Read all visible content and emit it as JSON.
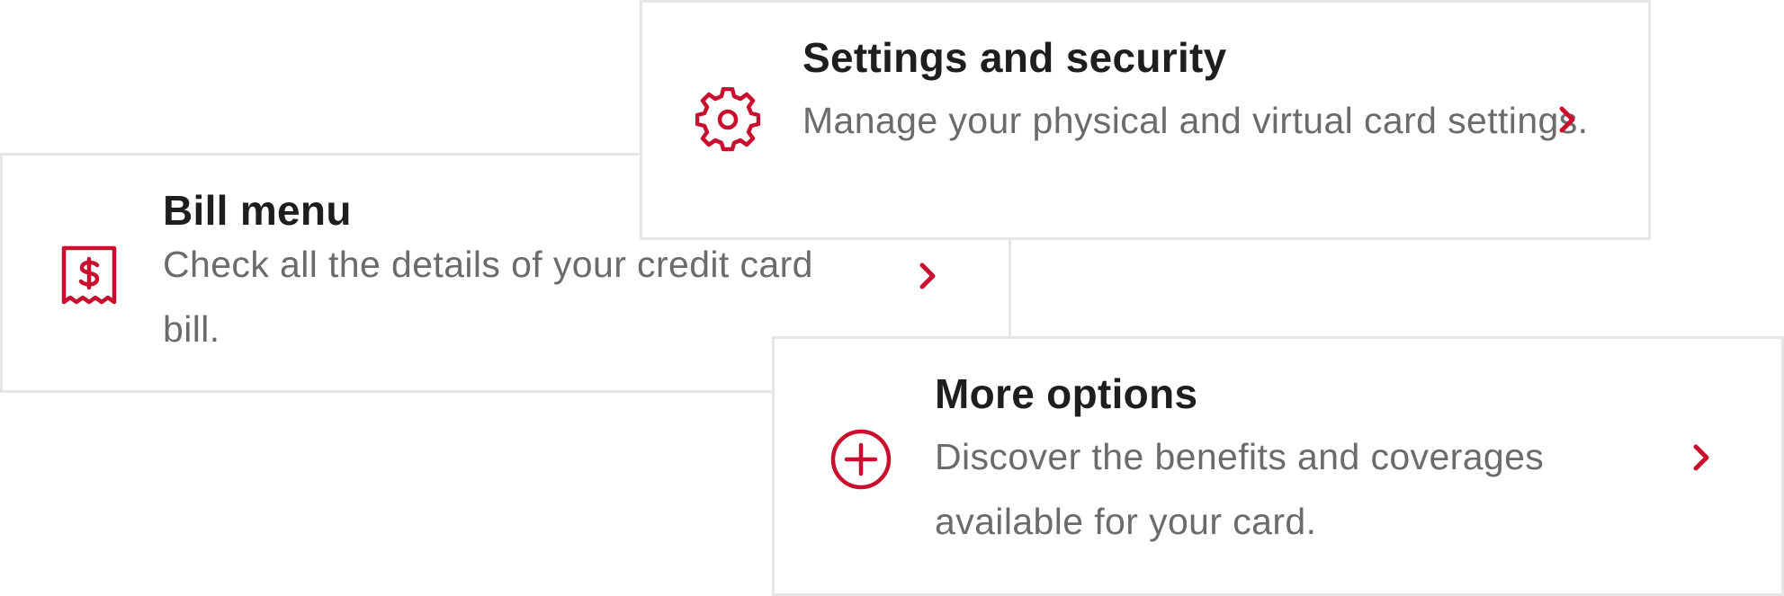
{
  "colors": {
    "accent": "#c8102e",
    "title": "#1e1e1e",
    "description": "#6b6b6b",
    "border": "#e6e6e6",
    "background": "#ffffff"
  },
  "cards": {
    "bill": {
      "icon": "receipt-dollar-icon",
      "title": "Bill menu",
      "description": "Check all the details of your credit card bill."
    },
    "settings": {
      "icon": "gear-icon",
      "title": "Settings and security",
      "description": "Manage your physical and virtual card settings."
    },
    "more": {
      "icon": "plus-circle-icon",
      "title": "More options",
      "description": "Discover the benefits and coverages available for your card."
    }
  }
}
